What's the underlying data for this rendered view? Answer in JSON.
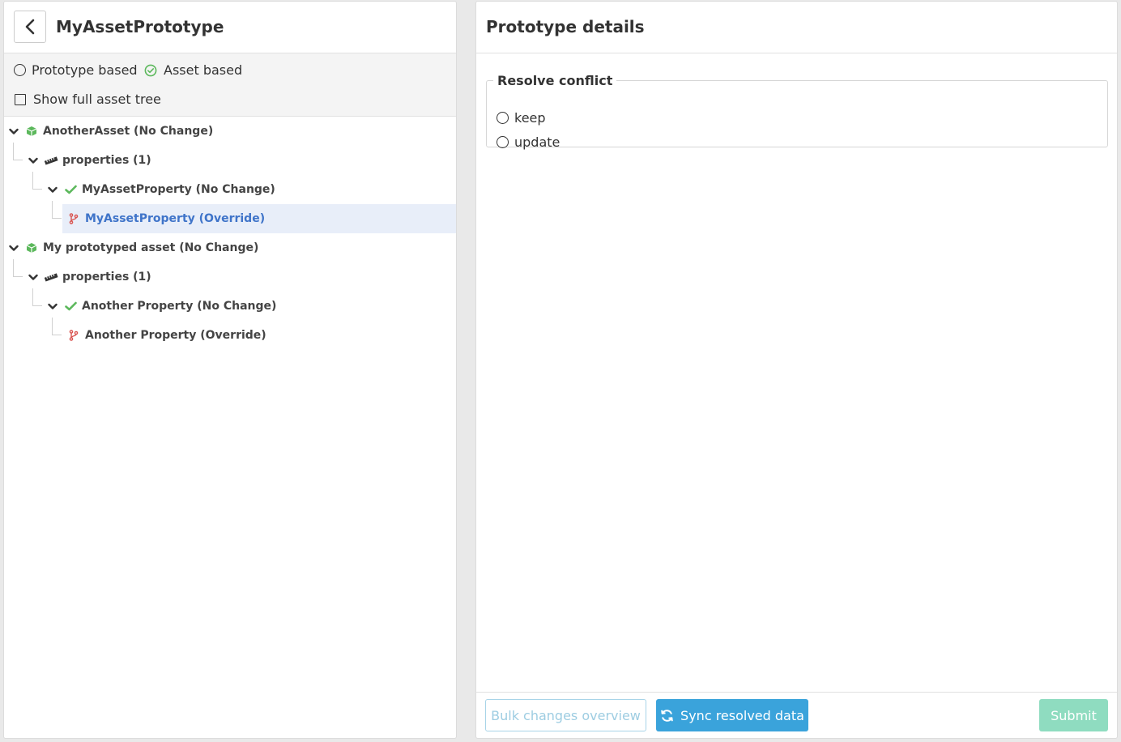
{
  "left": {
    "title": "MyAssetPrototype",
    "view_options": {
      "prototype_based": "Prototype based",
      "asset_based": "Asset based",
      "show_full_tree": "Show full asset tree"
    },
    "tree": [
      "AnotherAsset (No Change)",
      "properties (1)",
      "MyAssetProperty (No Change)",
      "MyAssetProperty (Override)",
      "My prototyped asset (No Change)",
      "properties (1)",
      "Another Property (No Change)",
      "Another Property (Override)"
    ]
  },
  "right": {
    "title": "Prototype details",
    "resolve": {
      "legend": "Resolve conflict",
      "options": [
        "keep",
        "update"
      ]
    }
  },
  "footer": {
    "bulk_label": "Bulk changes overview",
    "sync_label": "Sync resolved data",
    "submit_label": "Submit"
  },
  "colors": {
    "accent": "#3aa3db",
    "success": "#5cb85c",
    "override": "#d9534f",
    "selected_text": "#3f74c9",
    "submit": "#8fdcc0"
  }
}
